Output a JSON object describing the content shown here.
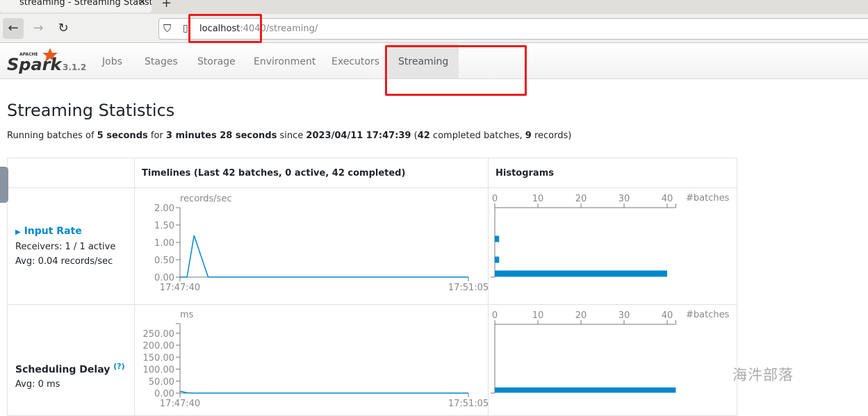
{
  "browser": {
    "tab_title": "streaming - Streaming Statistics",
    "url_host": "localhost",
    "url_port": ":4040",
    "url_path": "/streaming/"
  },
  "spark": {
    "logo_text": "Spark",
    "logo_apache": "APACHE",
    "version": "3.1.2",
    "nav": [
      {
        "label": "Jobs"
      },
      {
        "label": "Stages"
      },
      {
        "label": "Storage"
      },
      {
        "label": "Environment"
      },
      {
        "label": "Executors"
      },
      {
        "label": "Streaming",
        "active": true
      }
    ]
  },
  "page": {
    "title": "Streaming Statistics",
    "summary": {
      "p1": "Running batches of ",
      "interval": "5 seconds",
      "p2": " for ",
      "duration": "3 minutes 28 seconds",
      "p3": " since ",
      "since": "2023/04/11 17:47:39",
      "p4": " (",
      "batches": "42",
      "p5": " completed batches, ",
      "records": "9",
      "p6": " records)"
    },
    "table_headers": [
      "",
      "Timelines (Last 42 batches, 0 active, 42 completed)",
      "Histograms"
    ],
    "input_rate": {
      "title": "Input Rate",
      "receivers": "Receivers: 1 / 1 active",
      "avg": "Avg: 0.04 records/sec"
    },
    "scheduling_delay": {
      "title": "Scheduling Delay",
      "help": "(?)",
      "avg": "Avg: 0 ms"
    }
  },
  "colors": {
    "accent": "#0088cc",
    "annotation": "#f0191a"
  },
  "watermark": "海汼部落",
  "chart_data": [
    {
      "type": "line",
      "name": "input-rate-timeline",
      "ylabel": "records/sec",
      "ylim": [
        0,
        2
      ],
      "yticks": [
        "0.00",
        "0.50",
        "1.00",
        "1.50",
        "2.00"
      ],
      "xticks": [
        "17:47:40",
        "17:51:05"
      ],
      "x_interval_sec": 5,
      "values": [
        0,
        0,
        1.2,
        0.6,
        0,
        0,
        0,
        0,
        0,
        0,
        0,
        0,
        0,
        0,
        0,
        0,
        0,
        0,
        0,
        0,
        0,
        0,
        0,
        0,
        0,
        0,
        0,
        0,
        0,
        0,
        0,
        0,
        0,
        0,
        0,
        0,
        0,
        0,
        0,
        0,
        0,
        0
      ]
    },
    {
      "type": "bar",
      "orientation": "horizontal",
      "name": "input-rate-histogram",
      "xlabel": "#batches",
      "xlim": [
        0,
        42
      ],
      "xticks": [
        "0",
        "10",
        "20",
        "30",
        "40"
      ],
      "bins": [
        {
          "from": 1.0,
          "to": 1.2,
          "count": 1
        },
        {
          "from": 0.4,
          "to": 0.6,
          "count": 1
        },
        {
          "from": 0,
          "to": 0.2,
          "count": 40
        }
      ]
    },
    {
      "type": "line",
      "name": "scheduling-delay-timeline",
      "ylabel": "ms",
      "ylim": [
        0,
        290
      ],
      "yticks": [
        "0.00",
        "50.00",
        "100.00",
        "150.00",
        "200.00",
        "250.00"
      ],
      "xticks": [
        "17:47:40",
        "17:51:05"
      ],
      "x_interval_sec": 5,
      "values": [
        8,
        1,
        0,
        0,
        0,
        0,
        0,
        0,
        0,
        0,
        0,
        0,
        0,
        0,
        0,
        0,
        0,
        0,
        0,
        0,
        0,
        0,
        0,
        0,
        0,
        0,
        0,
        0,
        0,
        0,
        0,
        0,
        0,
        0,
        0,
        0,
        0,
        0,
        0,
        0,
        0,
        0
      ]
    },
    {
      "type": "bar",
      "orientation": "horizontal",
      "name": "scheduling-delay-histogram",
      "xlabel": "#batches",
      "xlim": [
        0,
        42
      ],
      "xticks": [
        "0",
        "10",
        "20",
        "30",
        "40"
      ],
      "bins": [
        {
          "from": 0,
          "to": 25,
          "count": 42
        }
      ]
    }
  ]
}
